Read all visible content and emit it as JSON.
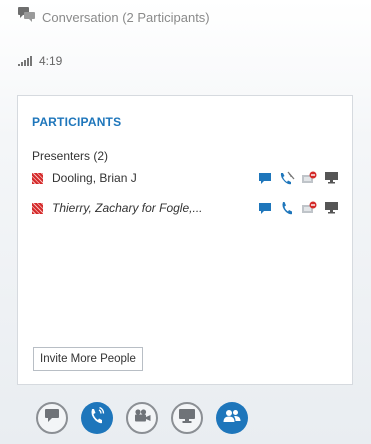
{
  "window": {
    "title": "Conversation (2 Participants)"
  },
  "status": {
    "time": "4:19"
  },
  "participants_panel": {
    "heading": "PARTICIPANTS",
    "presenters_heading": "Presenters (2)",
    "presenters": [
      {
        "name": "Dooling, Brian J",
        "italic": false,
        "audio": "muted"
      },
      {
        "name": "Thierry, Zachary for Fogle,...",
        "italic": true,
        "audio": "active"
      }
    ],
    "invite_button_label": "Invite More People"
  },
  "toolbar": {
    "buttons": [
      "im-button",
      "call-button",
      "video-button",
      "present-button",
      "participants-button"
    ]
  },
  "colors": {
    "accent": "#1e76bb",
    "presence_busy": "#d42a2a",
    "muted_gray": "#8b8f94"
  }
}
